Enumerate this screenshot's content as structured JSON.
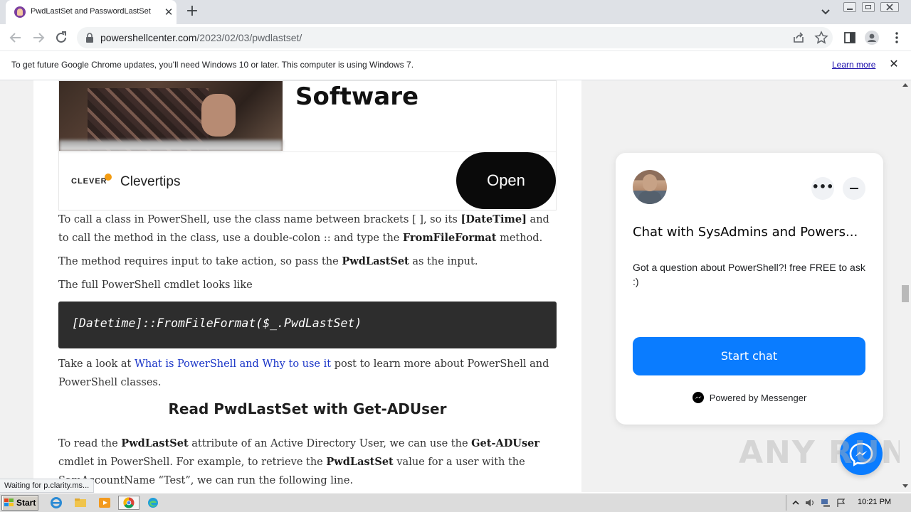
{
  "browser": {
    "tab_title": "PwdLastSet and PasswordLastSet",
    "tab_close": "✕",
    "new_tab": "+",
    "url_host": "powershellcenter.com",
    "url_path": "/2023/02/03/pwdlastset/"
  },
  "infobar": {
    "message": "To get future Google Chrome updates, you'll need Windows 10 or later. This computer is using Windows 7.",
    "link": "Learn more",
    "close": "✕"
  },
  "ad": {
    "headline": "Software",
    "brand_mark": "CLEVER",
    "brand_name": "Clevertips",
    "cta": "Open"
  },
  "article": {
    "para1": {
      "t1": "To call a class in PowerShell, use the class name between brackets [ ], so its ",
      "b1": "[DateTime]",
      "t2": " and to call the method in the class, use a double-colon :: and type the ",
      "b2": "FromFileFormat",
      "t3": " method."
    },
    "para2": {
      "t1": "The method requires input to take action, so pass the ",
      "b1": "PwdLastSet",
      "t2": " as the input."
    },
    "para3": "The full PowerShell cmdlet looks like",
    "code": "[Datetime]::FromFileFormat($_.PwdLastSet)",
    "para4": {
      "t1": "Take a look at ",
      "link": "What is PowerShell and Why to use it",
      "t2": " post to learn more about PowerShell and PowerShell classes."
    },
    "heading": "Read PwdLastSet with Get-ADUser",
    "para5": {
      "t1": "To read the ",
      "b1": "PwdLastSet",
      "t2": " attribute of an Active Directory User, we can use the ",
      "b2": "Get-ADUser",
      "t3": " cmdlet in PowerShell. For example, to retrieve the ",
      "b3": "PwdLastSet",
      "t4": " value for a user with the SamAccountName “Test”, we can run the following line."
    }
  },
  "chat": {
    "more": "•••",
    "title": "Chat with SysAdmins and Powers...",
    "message": "Got a question about PowerShell?! free FREE to ask :)",
    "start_button": "Start chat",
    "powered_by": "Powered by Messenger"
  },
  "watermark": "ANY RUN",
  "status_text": "Waiting for p.clarity.ms...",
  "taskbar": {
    "start": "Start",
    "clock": "10:21 PM"
  },
  "colors": {
    "chat_accent": "#0a7cff",
    "link": "#1a35c8",
    "code_bg": "#2d2d2d"
  }
}
